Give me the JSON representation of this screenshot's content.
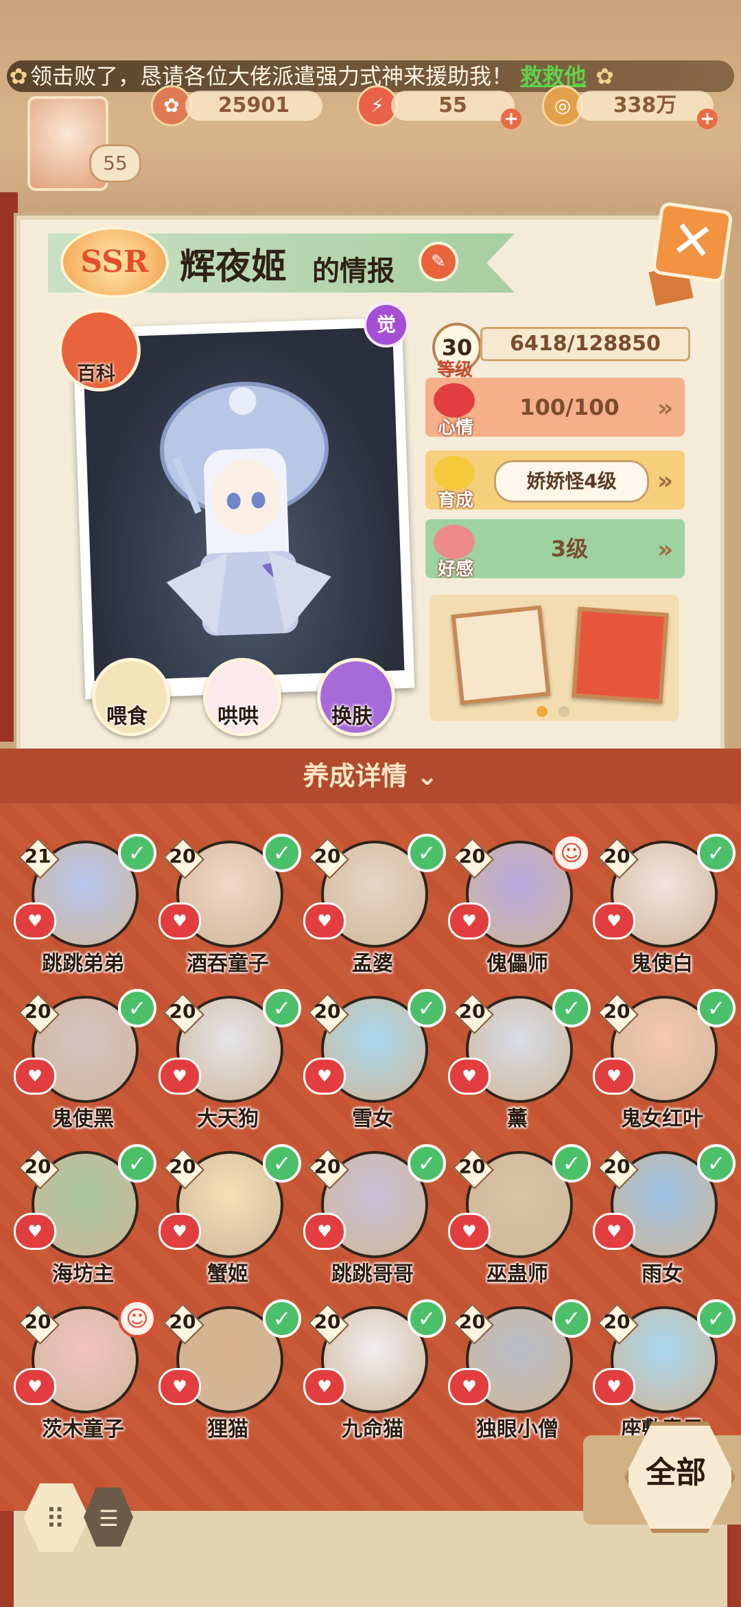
{
  "ticker": {
    "text": "领击败了，恳请各位大佬派遣强力式神来援助我！",
    "link": "救救他"
  },
  "resources": {
    "jade": "25901",
    "stamina": "55",
    "coins": "338万",
    "player_level": "55"
  },
  "header": {
    "rarity_badge": "SSR",
    "name": "辉夜姬",
    "suffix": "的情报",
    "encyclopedia_label": "百科",
    "awaken_badge": "觉"
  },
  "stats": {
    "level": "30",
    "level_label": "等级",
    "exp": "6418/128850",
    "mood_label": "心情",
    "mood_value": "100/100",
    "cultivate_label": "育成",
    "cultivate_value": "娇娇怪4级",
    "favor_label": "好感",
    "favor_value": "3级"
  },
  "actions": [
    {
      "label": "喂食"
    },
    {
      "label": "哄哄"
    },
    {
      "label": "换肤"
    }
  ],
  "detail_label": "养成详情",
  "all_label": "全部",
  "characters": [
    {
      "level": "21",
      "name": "跳跳弟弟",
      "checked": true
    },
    {
      "level": "20",
      "name": "酒吞童子",
      "checked": true
    },
    {
      "level": "20",
      "name": "孟婆",
      "checked": true
    },
    {
      "level": "20",
      "name": "傀儡师",
      "checked": false
    },
    {
      "level": "20",
      "name": "鬼使白",
      "checked": true
    },
    {
      "level": "20",
      "name": "鬼使黑",
      "checked": true
    },
    {
      "level": "20",
      "name": "大天狗",
      "checked": true
    },
    {
      "level": "20",
      "name": "雪女",
      "checked": true
    },
    {
      "level": "20",
      "name": "薰",
      "checked": true
    },
    {
      "level": "20",
      "name": "鬼女红叶",
      "checked": true
    },
    {
      "level": "20",
      "name": "海坊主",
      "checked": true
    },
    {
      "level": "20",
      "name": "蟹姬",
      "checked": true
    },
    {
      "level": "20",
      "name": "跳跳哥哥",
      "checked": true
    },
    {
      "level": "20",
      "name": "巫蛊师",
      "checked": true
    },
    {
      "level": "20",
      "name": "雨女",
      "checked": true
    },
    {
      "level": "20",
      "name": "茨木童子",
      "checked": false
    },
    {
      "level": "20",
      "name": "狸猫",
      "checked": true
    },
    {
      "level": "20",
      "name": "九命猫",
      "checked": true
    },
    {
      "level": "20",
      "name": "独眼小僧",
      "checked": true
    },
    {
      "level": "20",
      "name": "座敷童子",
      "checked": true
    }
  ],
  "colors": {
    "mood_row": "#f5b08a",
    "cultivate_row": "#f6cf7c",
    "favor_row": "#9fd2a3",
    "grid_bg": "#c95a38",
    "check": "#4cbf6a",
    "heart": "#e23e40"
  },
  "icons": {
    "close": "close-icon",
    "edit": "edit-icon",
    "heart": "heart-icon",
    "check": "check-icon",
    "chevron": "chevron-down-icon"
  }
}
